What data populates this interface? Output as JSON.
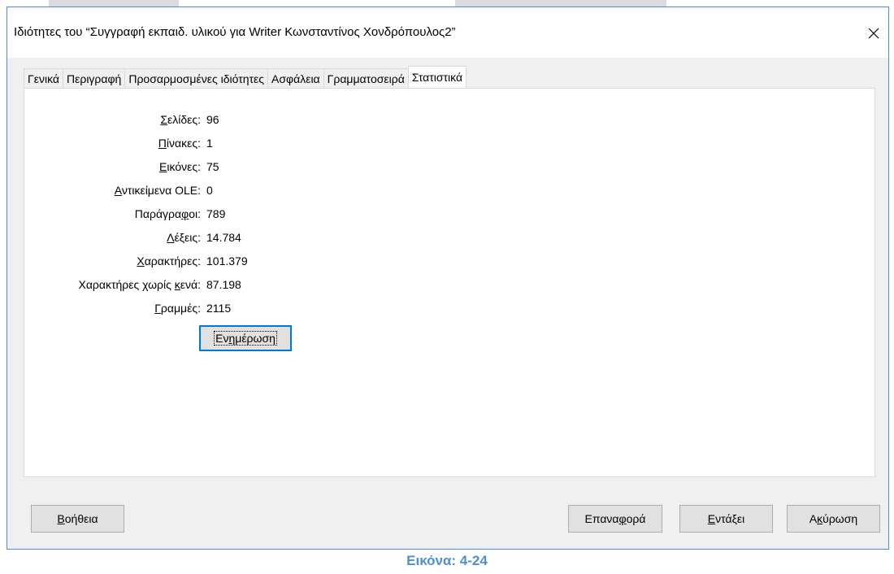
{
  "dialog": {
    "title": "Ιδιότητες του “Συγγραφή εκπαιδ. υλικού για Writer Κωνσταντίνος Χονδρόπουλος2”",
    "close_icon": "close-icon"
  },
  "tabs": [
    {
      "label": "Γενικά",
      "active": false
    },
    {
      "label": "Περιγραφή",
      "active": false
    },
    {
      "label": "Προσαρμοσμένες ιδιότητες",
      "active": false
    },
    {
      "label": "Ασφάλεια",
      "active": false
    },
    {
      "label": "Γραμματοσειρά",
      "active": false
    },
    {
      "label": "Στατιστικά",
      "active": true
    }
  ],
  "stats": [
    {
      "label_pre": "",
      "label_u": "Σ",
      "label_post": "ελίδες:",
      "value": "96"
    },
    {
      "label_pre": "",
      "label_u": "Π",
      "label_post": "ίνακες:",
      "value": "1"
    },
    {
      "label_pre": "",
      "label_u": "Ε",
      "label_post": "ικόνες:",
      "value": "75"
    },
    {
      "label_pre": "",
      "label_u": "Α",
      "label_post": "ντικείμενα OLE:",
      "value": "0"
    },
    {
      "label_pre": "Παράγρα",
      "label_u": "φ",
      "label_post": "οι:",
      "value": "789"
    },
    {
      "label_pre": "",
      "label_u": "Λ",
      "label_post": "έξεις:",
      "value": "14.784"
    },
    {
      "label_pre": "",
      "label_u": "Χ",
      "label_post": "αρακτήρες:",
      "value": "101.379"
    },
    {
      "label_pre": "Χαρακτήρες χωρίς ",
      "label_u": "κ",
      "label_post": "ενά:",
      "value": "87.198"
    },
    {
      "label_pre": "",
      "label_u": "Γ",
      "label_post": "ραμμές:",
      "value": "2115"
    }
  ],
  "update_button": {
    "pre": "Εν",
    "u": "η",
    "post": "μέρωση"
  },
  "buttons": {
    "help": {
      "pre": "",
      "u": "Β",
      "post": "οήθεια"
    },
    "reset": {
      "pre": "Επανα",
      "u": "φ",
      "post": "ορά"
    },
    "ok": {
      "pre": "",
      "u": "Ε",
      "post": "ντάξει"
    },
    "cancel": {
      "pre": "Α",
      "u": "κ",
      "post": "ύρωση"
    }
  },
  "caption": "Εικόνα: 4-24",
  "colors": {
    "accent": "#0078d7",
    "caption": "#4f8fd6",
    "dialog_border": "#4a8edb"
  }
}
